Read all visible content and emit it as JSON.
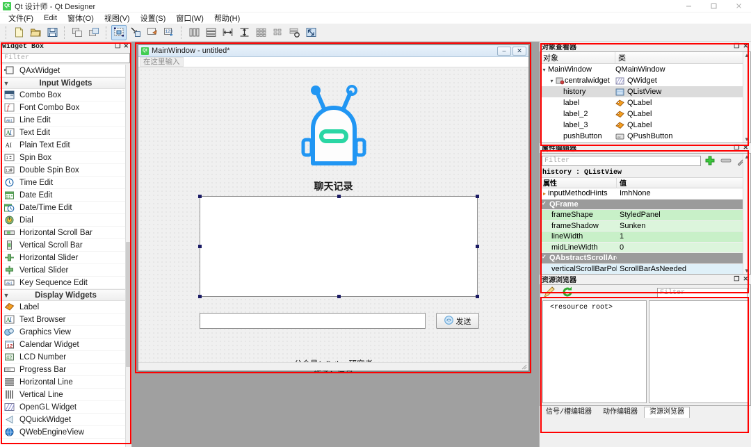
{
  "window": {
    "app_logo": "Qt",
    "title": "Qt 设计师 - Qt Designer",
    "minimize": "minimize-icon",
    "maximize": "maximize-icon",
    "close": "close-icon"
  },
  "menubar": {
    "items": [
      {
        "label": "文件(F)"
      },
      {
        "label": "Edit"
      },
      {
        "label": "窗体(O)"
      },
      {
        "label": "视图(V)"
      },
      {
        "label": "设置(S)"
      },
      {
        "label": "窗口(W)"
      },
      {
        "label": "帮助(H)"
      }
    ]
  },
  "toolbar": {
    "groups": [
      [
        "new-form-icon",
        "open-form-icon",
        "save-form-icon"
      ],
      [
        "undo-icon",
        "redo-icon"
      ],
      [
        "edit-widgets-icon",
        "edit-signals-slots-icon",
        "edit-buddies-icon",
        "edit-tab-order-icon"
      ],
      [
        "layout-horizontally-icon",
        "layout-vertically-icon",
        "layout-splitter-h-icon",
        "layout-splitter-v-icon",
        "layout-grid-icon",
        "layout-form-icon",
        "break-layout-icon",
        "adjust-size-icon"
      ]
    ],
    "active_index": "edit-widgets-icon"
  },
  "widget_box": {
    "title": "Widget Box",
    "filter_placeholder": "Filter",
    "float_icon": "float-icon",
    "close_icon": "close-icon",
    "items": [
      {
        "type": "item",
        "label": "QAxWidget",
        "icon": "qaxwidget-icon"
      },
      {
        "type": "group",
        "label": "Input Widgets",
        "icon": "chevron-down-icon"
      },
      {
        "type": "item",
        "label": "Combo Box",
        "icon": "combobox-icon"
      },
      {
        "type": "item",
        "label": "Font Combo Box",
        "icon": "fontcombobox-icon"
      },
      {
        "type": "item",
        "label": "Line Edit",
        "icon": "lineedit-icon"
      },
      {
        "type": "item",
        "label": "Text Edit",
        "icon": "textedit-icon"
      },
      {
        "type": "item",
        "label": "Plain Text Edit",
        "icon": "plaintextedit-icon"
      },
      {
        "type": "item",
        "label": "Spin Box",
        "icon": "spinbox-icon"
      },
      {
        "type": "item",
        "label": "Double Spin Box",
        "icon": "doublespinbox-icon"
      },
      {
        "type": "item",
        "label": "Time Edit",
        "icon": "timeedit-icon"
      },
      {
        "type": "item",
        "label": "Date Edit",
        "icon": "dateedit-icon"
      },
      {
        "type": "item",
        "label": "Date/Time Edit",
        "icon": "datetimeedit-icon"
      },
      {
        "type": "item",
        "label": "Dial",
        "icon": "dial-icon"
      },
      {
        "type": "item",
        "label": "Horizontal Scroll Bar",
        "icon": "hscrollbar-icon"
      },
      {
        "type": "item",
        "label": "Vertical Scroll Bar",
        "icon": "vscrollbar-icon"
      },
      {
        "type": "item",
        "label": "Horizontal Slider",
        "icon": "hslider-icon"
      },
      {
        "type": "item",
        "label": "Vertical Slider",
        "icon": "vslider-icon"
      },
      {
        "type": "item",
        "label": "Key Sequence Edit",
        "icon": "keysequenceedit-icon"
      },
      {
        "type": "group",
        "label": "Display Widgets",
        "icon": "chevron-down-icon"
      },
      {
        "type": "item",
        "label": "Label",
        "icon": "label-icon"
      },
      {
        "type": "item",
        "label": "Text Browser",
        "icon": "textbrowser-icon"
      },
      {
        "type": "item",
        "label": "Graphics View",
        "icon": "graphicsview-icon"
      },
      {
        "type": "item",
        "label": "Calendar Widget",
        "icon": "calendar-icon"
      },
      {
        "type": "item",
        "label": "LCD Number",
        "icon": "lcdnumber-icon"
      },
      {
        "type": "item",
        "label": "Progress Bar",
        "icon": "progressbar-icon"
      },
      {
        "type": "item",
        "label": "Horizontal Line",
        "icon": "hline-icon"
      },
      {
        "type": "item",
        "label": "Vertical Line",
        "icon": "vline-icon"
      },
      {
        "type": "item",
        "label": "OpenGL Widget",
        "icon": "opengl-icon"
      },
      {
        "type": "item",
        "label": "QQuickWidget",
        "icon": "qquickwidget-icon"
      },
      {
        "type": "item",
        "label": "QWebEngineView",
        "icon": "qwebengineview-icon"
      }
    ]
  },
  "form_window": {
    "logo": "Qt",
    "title": "MainWindow - untitled*",
    "minimize_label": "–",
    "close_label": "✕",
    "menu_placeholder": "在这里输入",
    "robot_icon": "robot-mascot-icon",
    "robot_body_color": "#2196f3",
    "robot_mouth_color": "#2ad6a4",
    "chat_title": "聊天记录",
    "history_widget": "history",
    "message_input_value": "",
    "send_button_label": "发送",
    "send_button_icon": "send-icon",
    "credit_line_1": "公众号：Python研究者",
    "credit_line_2": "作者：辰哥"
  },
  "object_inspector": {
    "title": "对象查看器",
    "float_icon": "float-icon",
    "close_icon": "close-icon",
    "columns": [
      "对象",
      "类"
    ],
    "rows": [
      {
        "name": "MainWindow",
        "class": "QMainWindow",
        "indent": 0,
        "chevron": "⌄",
        "icon": "",
        "selected": false
      },
      {
        "name": "centralwidget",
        "class": "QWidget",
        "indent": 1,
        "chevron": "⌄",
        "icon": "centralwidget-icon",
        "selected": false
      },
      {
        "name": "history",
        "class": "QListView",
        "indent": 2,
        "chevron": "",
        "icon": "listview-icon",
        "selected": true
      },
      {
        "name": "label",
        "class": "QLabel",
        "indent": 2,
        "chevron": "",
        "icon": "label-icon",
        "selected": false
      },
      {
        "name": "label_2",
        "class": "QLabel",
        "indent": 2,
        "chevron": "",
        "icon": "label-icon",
        "selected": false
      },
      {
        "name": "label_3",
        "class": "QLabel",
        "indent": 2,
        "chevron": "",
        "icon": "label-icon",
        "selected": false
      },
      {
        "name": "pushButton",
        "class": "QPushButton",
        "indent": 2,
        "chevron": "",
        "icon": "pushbutton-icon",
        "selected": false
      }
    ]
  },
  "property_editor": {
    "title": "属性编辑器",
    "float_icon": "float-icon",
    "close_icon": "close-icon",
    "filter_placeholder": "Filter",
    "add_icon": "plus-icon",
    "remove_icon": "minus-icon",
    "configure_icon": "wrench-icon",
    "object_line": "history : QListView",
    "columns": [
      "属性",
      "值"
    ],
    "rows": [
      {
        "key": "inputMethodHints",
        "value": "ImhNone",
        "style": "expandable"
      },
      {
        "key": "QFrame",
        "value": "",
        "style": "group"
      },
      {
        "key": "frameShape",
        "value": "StyledPanel",
        "style": "green"
      },
      {
        "key": "frameShadow",
        "value": "Sunken",
        "style": "green2"
      },
      {
        "key": "lineWidth",
        "value": "1",
        "style": "green"
      },
      {
        "key": "midLineWidth",
        "value": "0",
        "style": "green2"
      },
      {
        "key": "QAbstractScrollArea",
        "value": "",
        "style": "group"
      },
      {
        "key": "verticalScrollBarPol...",
        "value": "ScrollBarAsNeeded",
        "style": "blue"
      }
    ]
  },
  "resource_browser": {
    "title": "资源浏览器",
    "float_icon": "float-icon",
    "close_icon": "close-icon",
    "edit_icon": "pencil-icon",
    "reload_icon": "reload-icon",
    "filter_placeholder": "Filter",
    "root_label": "<resource root>",
    "tabs": [
      {
        "label": "信号/槽编辑器",
        "active": false
      },
      {
        "label": "动作编辑器",
        "active": false
      },
      {
        "label": "资源浏览器",
        "active": true
      }
    ]
  }
}
